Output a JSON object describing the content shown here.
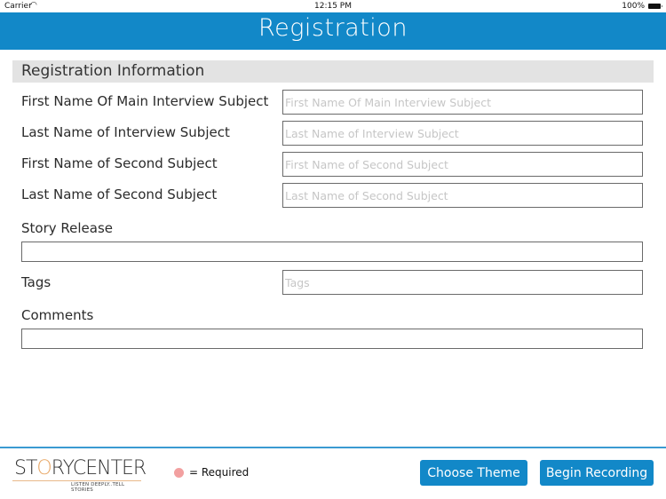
{
  "status_bar": {
    "carrier": "Carrier",
    "wifi_icon": "wifi-icon",
    "time": "12:15 PM",
    "battery_percent": "100%",
    "battery_icon": "battery-icon"
  },
  "nav": {
    "title": "Registration",
    "color": "#1288c8"
  },
  "section": {
    "title": "Registration Information"
  },
  "fields": [
    {
      "label": "First Name Of Main Interview Subject",
      "placeholder": "First Name Of Main Interview Subject",
      "value": ""
    },
    {
      "label": "Last Name of Interview Subject",
      "placeholder": "Last Name of Interview Subject",
      "value": ""
    },
    {
      "label": "First Name of Second Subject",
      "placeholder": "First Name of Second Subject",
      "value": ""
    },
    {
      "label": "Last Name of Second Subject",
      "placeholder": "Last Name of Second Subject",
      "value": ""
    }
  ],
  "story_release": {
    "label": "Story Release",
    "value": ""
  },
  "tags": {
    "label": "Tags",
    "placeholder": "Tags",
    "value": ""
  },
  "comments": {
    "label": "Comments",
    "value": ""
  },
  "footer": {
    "logo": {
      "word_a": "ST",
      "word_o": "O",
      "word_b": "RYCENTER",
      "tagline": "LISTEN DEEPLY..TELL STORIES"
    },
    "required_marker_color": "#f2a0a0",
    "required_text": "= Required",
    "choose_theme_label": "Choose Theme",
    "begin_recording_label": "Begin Recording"
  }
}
